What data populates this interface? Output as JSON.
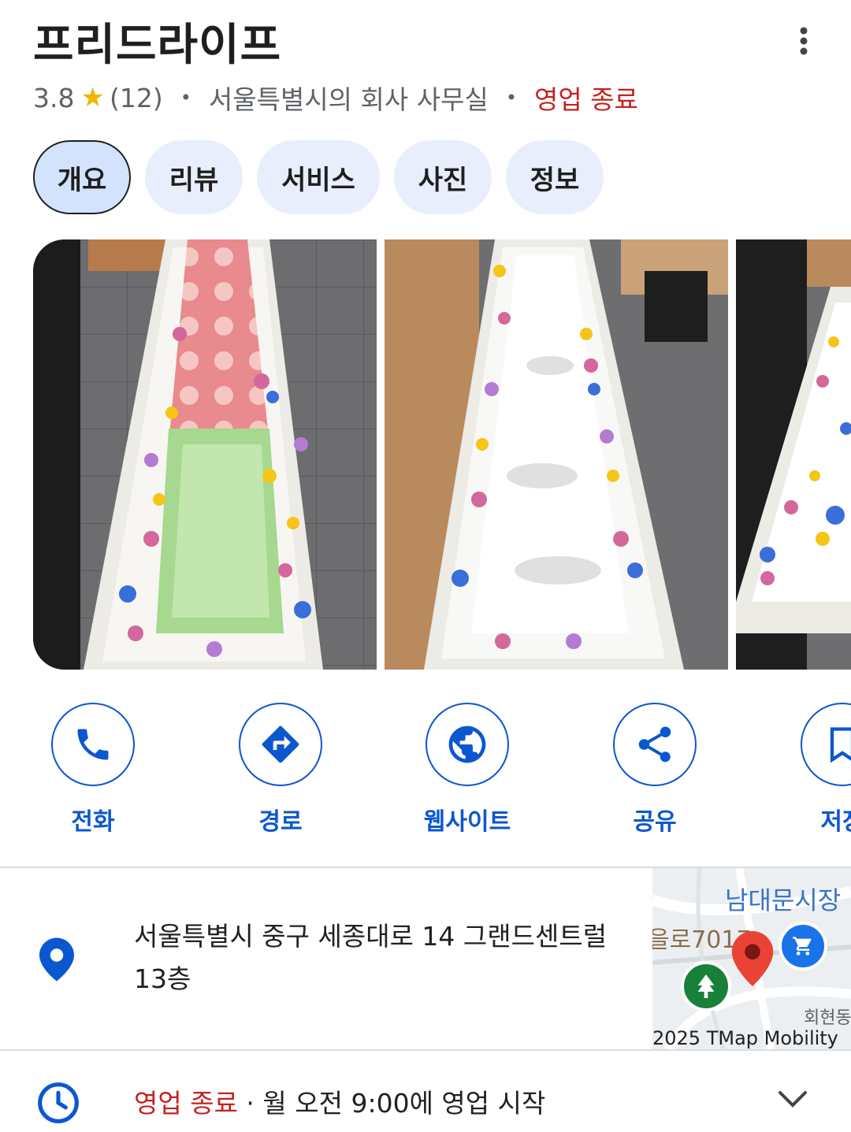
{
  "place": {
    "name": "프리드라이프",
    "rating": "3.8",
    "review_count": "(12)",
    "category": "서울특별시의 회사 사무실",
    "status": "영업 종료"
  },
  "tabs": [
    {
      "label": "개요",
      "active": true
    },
    {
      "label": "리뷰",
      "active": false
    },
    {
      "label": "서비스",
      "active": false
    },
    {
      "label": "사진",
      "active": false
    },
    {
      "label": "정보",
      "active": false
    }
  ],
  "actions": [
    {
      "label": "전화",
      "icon": "phone-icon"
    },
    {
      "label": "경로",
      "icon": "directions-icon"
    },
    {
      "label": "웹사이트",
      "icon": "globe-icon"
    },
    {
      "label": "공유",
      "icon": "share-icon"
    },
    {
      "label": "저장",
      "icon": "bookmark-icon"
    }
  ],
  "address": {
    "text": "서울특별시 중구 세종대로 14 그랜드센트럴 13층"
  },
  "map": {
    "label_namdaemun": "남대문시장",
    "label_road": "을로7017",
    "label_hoehyeon": "회현동",
    "copyright": "2025 TMap Mobility"
  },
  "hours": {
    "status": "영업 종료",
    "separator": " · ",
    "next": "월 오전 9:00에 영업 시작"
  },
  "colors": {
    "accent": "#0b57d0",
    "closed_red": "#c5221f",
    "tab_bg": "#e8eefb",
    "star": "#f4b400"
  }
}
